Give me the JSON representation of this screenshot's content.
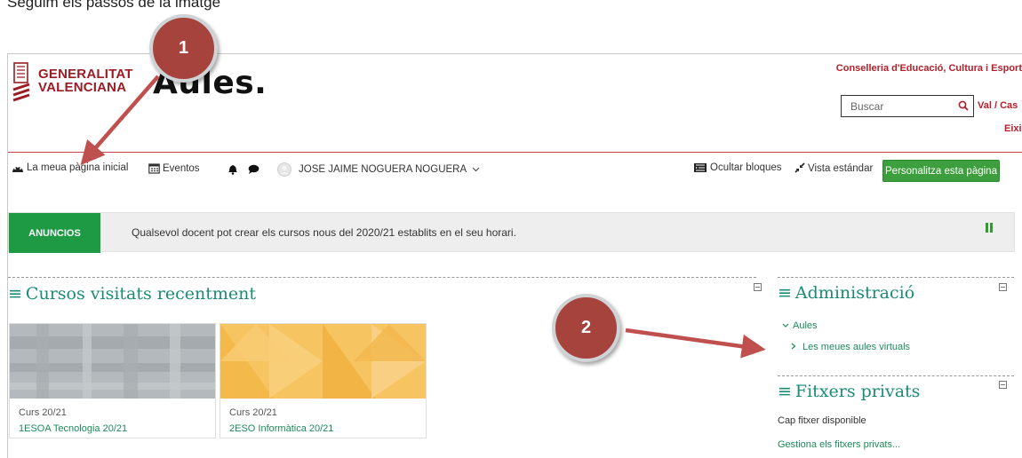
{
  "caption": "Seguim els passos de la imatge:",
  "header": {
    "org_line1": "GENERALITAT",
    "org_line2": "VALENCIANA",
    "app_logo": "Aules.",
    "department": "Conselleria d'Educació, Cultura i Esport",
    "search_placeholder": "Buscar",
    "language": "Val / Cas",
    "exit": "Eixir"
  },
  "nav": {
    "home": "La meua pàgina inicial",
    "events": "Eventos",
    "user": "JOSE JAIME NOGUERA NOGUERA",
    "hide_blocks": "Ocultar bloques",
    "standard_view": "Vista estándar",
    "customize": "Personalitza esta pàgina"
  },
  "announcements": {
    "badge": "ANUNCIOS",
    "text": "Qualsevol docent pot crear els cursos nous del 2020/21 establits en el seu horari."
  },
  "recent_courses": {
    "title": "Cursos visitats recentment",
    "items": [
      {
        "category": "Curs 20/21",
        "name": "1ESOA Tecnologia 20/21"
      },
      {
        "category": "Curs 20/21",
        "name": "2ESO Informàtica 20/21"
      }
    ]
  },
  "administration": {
    "title": "Administració",
    "section": "Aules",
    "link": "Les meues aules virtuals"
  },
  "private_files": {
    "title": "Fitxers privats",
    "empty": "Cap fitxer disponible",
    "manage": "Gestiona els fitxers privats..."
  },
  "callouts": {
    "step1": "1",
    "step2": "2"
  },
  "colors": {
    "accent": "#1c8a77",
    "brand_red": "#b3202b",
    "success": "#1e9a45",
    "callout": "#a6433d"
  }
}
